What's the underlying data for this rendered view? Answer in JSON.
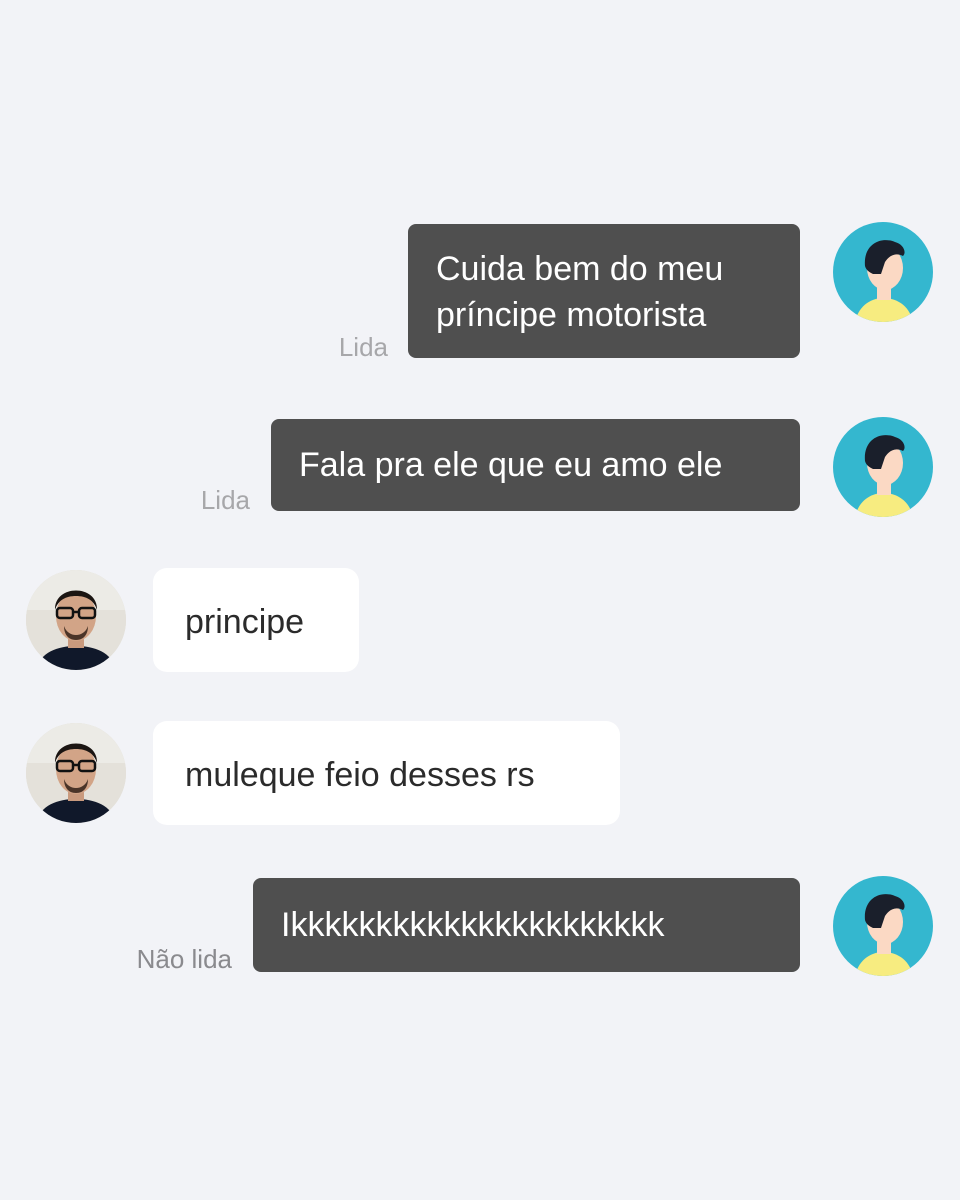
{
  "colors": {
    "background": "#f2f3f7",
    "outgoing_bubble": "#4f4f4f",
    "incoming_bubble": "#ffffff",
    "avatar_accent": "#34b7cf"
  },
  "messages": [
    {
      "direction": "outgoing",
      "lines": [
        "Cuida bem do meu",
        "príncipe motorista"
      ],
      "status": "Lida",
      "avatar": "user-avatar-icon"
    },
    {
      "direction": "outgoing",
      "lines": [
        "Fala pra ele que eu amo ele"
      ],
      "status": "Lida",
      "avatar": "user-avatar-icon"
    },
    {
      "direction": "incoming",
      "lines": [
        "principe"
      ],
      "avatar": "contact-photo"
    },
    {
      "direction": "incoming",
      "lines": [
        "muleque feio desses rs"
      ],
      "avatar": "contact-photo"
    },
    {
      "direction": "outgoing",
      "lines": [
        "Ikkkkkkkkkkkkkkkkkkkkkk"
      ],
      "status": "Não lida",
      "avatar": "user-avatar-icon"
    }
  ]
}
